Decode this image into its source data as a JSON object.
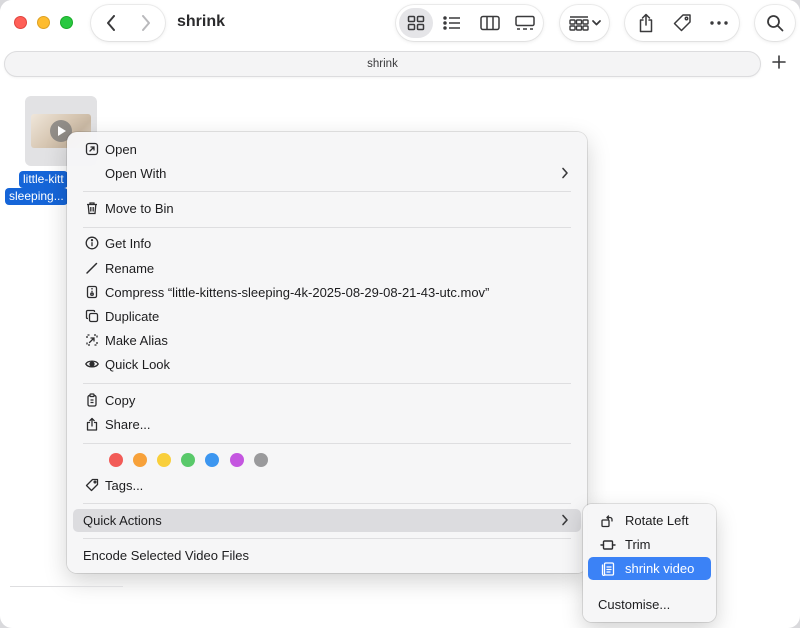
{
  "window": {
    "title": "shrink"
  },
  "toolbar": {
    "back": "chevron-left-icon",
    "forward": "chevron-right-icon",
    "views": [
      "grid-view-icon",
      "list-view-icon",
      "column-view-icon",
      "gallery-view-icon"
    ],
    "group": "group-icon",
    "share": "share-icon",
    "tag": "tag-icon",
    "more": "more-icon",
    "search": "search-icon"
  },
  "pathbar": {
    "label": "shrink"
  },
  "file": {
    "label_line1": "little-kitt",
    "label_line2": "sleeping..."
  },
  "menu": {
    "open": "Open",
    "open_with": "Open With",
    "move_to_bin": "Move to Bin",
    "get_info": "Get Info",
    "rename": "Rename",
    "compress": "Compress “little-kittens-sleeping-4k-2025-08-29-08-21-43-utc.mov”",
    "duplicate": "Duplicate",
    "make_alias": "Make Alias",
    "quick_look": "Quick Look",
    "copy": "Copy",
    "share": "Share...",
    "tags": "Tags...",
    "quick_actions": "Quick Actions",
    "encode": "Encode Selected Video Files",
    "tag_colors": [
      "#f25b57",
      "#f7a13a",
      "#f9cf3b",
      "#59c96a",
      "#3c96f0",
      "#c456e0",
      "#9a9a9c"
    ]
  },
  "submenu": {
    "rotate_left": "Rotate Left",
    "trim": "Trim",
    "shrink_video": "shrink video",
    "customise": "Customise..."
  },
  "colors": {
    "accent": "#3b82f6",
    "selection": "#1565d8"
  }
}
